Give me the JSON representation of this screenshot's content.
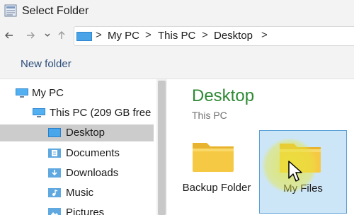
{
  "window": {
    "title": "Select Folder"
  },
  "nav": {
    "back_icon": "arrow-left-icon",
    "forward_icon": "arrow-right-icon",
    "recent_icon": "chevron-down-icon",
    "up_icon": "arrow-up-icon"
  },
  "address": {
    "crumbs": [
      "My PC",
      "This PC",
      "Desktop"
    ],
    "separator": ">"
  },
  "command_bar": {
    "new_folder_label": "New folder"
  },
  "sidebar": {
    "items": [
      {
        "label": "My PC",
        "icon": "computer-icon"
      },
      {
        "label": "This PC (209 GB free",
        "icon": "monitor-icon"
      },
      {
        "label": "Desktop",
        "icon": "desktop-folder-icon",
        "selected": true
      },
      {
        "label": "Documents",
        "icon": "documents-folder-icon"
      },
      {
        "label": "Downloads",
        "icon": "downloads-folder-icon"
      },
      {
        "label": "Music",
        "icon": "music-folder-icon"
      },
      {
        "label": "Pictures",
        "icon": "pictures-folder-icon"
      }
    ]
  },
  "content": {
    "title": "Desktop",
    "subtitle": "This PC",
    "folders": [
      {
        "label": "Backup Folder",
        "icon": "folder-icon",
        "selected": false
      },
      {
        "label": "My Files",
        "icon": "folder-icon",
        "selected": true
      }
    ]
  },
  "colors": {
    "accent_green": "#2f8a35",
    "selection_blue": "#cde6f7",
    "folder_yellow": "#f6c945"
  }
}
